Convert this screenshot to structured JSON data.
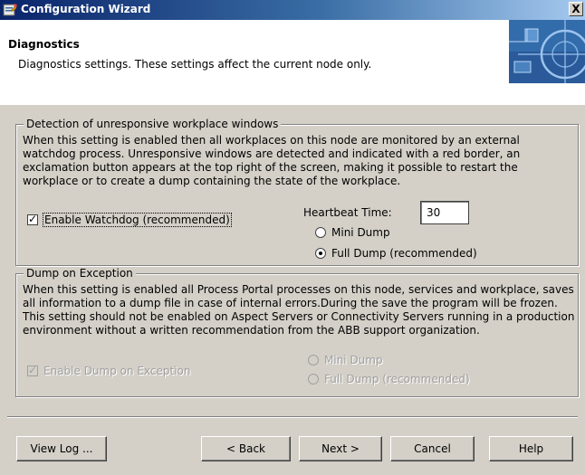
{
  "window": {
    "title": "Configuration Wizard",
    "close": "X",
    "icon": "wizard-app-icon"
  },
  "header": {
    "title": "Diagnostics",
    "description": "Diagnostics settings. These settings affect the current node only.",
    "graphic": "globe-banner-graphic"
  },
  "watchdog": {
    "legend": "Detection of unresponsive workplace windows",
    "description": "When this setting is enabled then all workplaces on this node are monitored by an external watchdog process. Unresponsive windows are detected and indicated with a red border, an exclamation button appears at the top right of the screen, making it possible to restart the workplace or to create a dump containing the state of the workplace.",
    "enable_label": "Enable Watchdog (recommended)",
    "enable_checked": true,
    "heartbeat_label": "Heartbeat Time:",
    "heartbeat_value": "30",
    "mini_dump_label": "Mini Dump",
    "full_dump_label": "Full Dump (recommended)",
    "selected_dump": "full"
  },
  "dump": {
    "legend": "Dump on Exception",
    "description": "When this setting is enabled all Process Portal processes on this node, services and workplace, saves all information to a dump file in case of internal errors.During the save the program will be frozen. This setting should not be enabled on Aspect Servers or Connectivity Servers running in a production environment without a written recommendation from the ABB support organization.",
    "enable_label": "Enable Dump on Exception",
    "enable_checked": true,
    "enabled": false,
    "mini_dump_label": "Mini Dump",
    "full_dump_label": "Full Dump (recommended)"
  },
  "buttons": {
    "view_log": "View Log ...",
    "back": "< Back",
    "next": "Next >",
    "cancel": "Cancel",
    "help": "Help"
  },
  "colors": {
    "title_start": "#0a246a",
    "title_end": "#a6caf0",
    "face": "#d4d0c8",
    "disabled": "#a0a0a0"
  }
}
